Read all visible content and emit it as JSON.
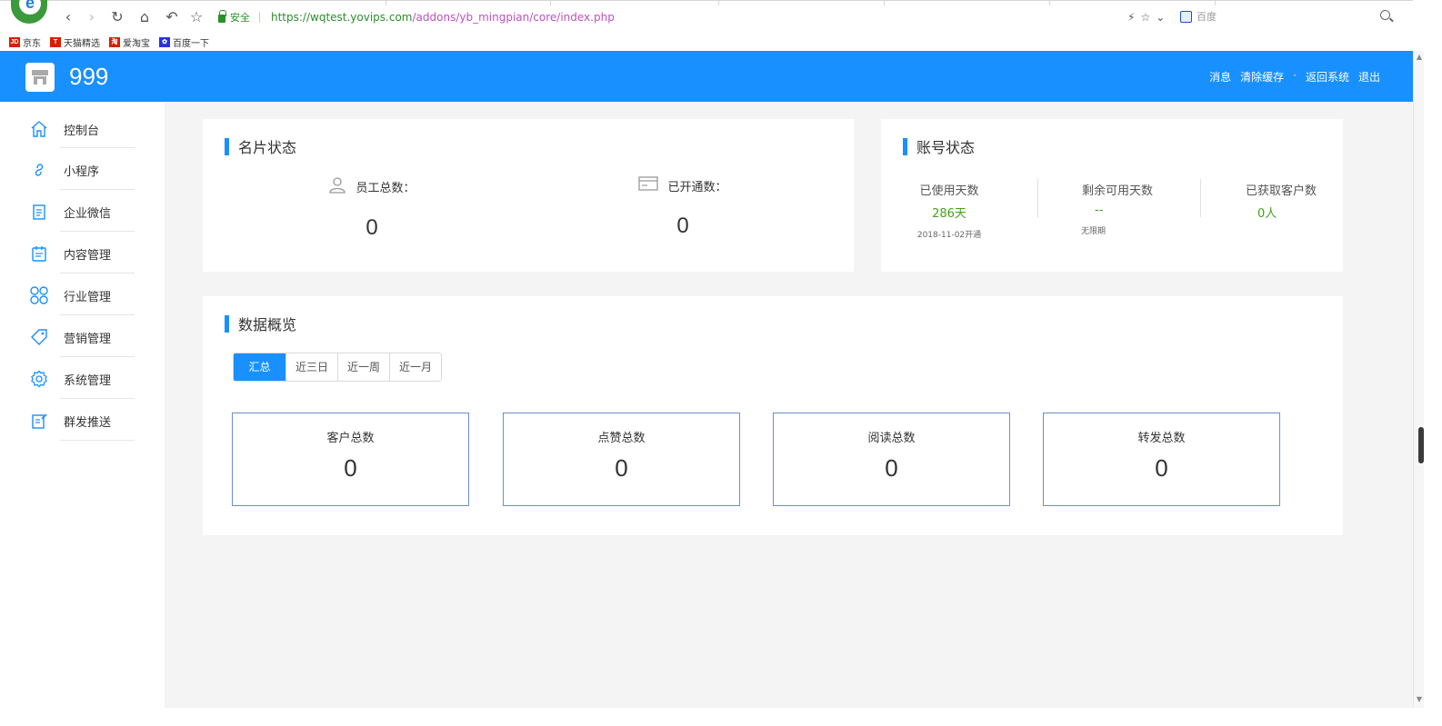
{
  "browser": {
    "secure_label": "安全",
    "url_host": "https://wqtest.yovips.com",
    "url_path": "/addons/yb_mingpian/core/index.php",
    "search_engine": "百度",
    "bookmarks": [
      {
        "label": "京东",
        "icon": "jd-icon",
        "color": "#d81e06",
        "mark": "JD"
      },
      {
        "label": "天猫精选",
        "icon": "tmall-icon",
        "color": "#d81e06",
        "mark": "T"
      },
      {
        "label": "爱淘宝",
        "icon": "aitaobao-icon",
        "color": "#d81e06",
        "mark": "淘"
      },
      {
        "label": "百度一下",
        "icon": "baidu-icon",
        "color": "#2932e1",
        "mark": "✿"
      }
    ]
  },
  "header": {
    "title": "999",
    "links": [
      "消息",
      "清除缓存",
      "返回系统",
      "退出"
    ],
    "bg_color": "#1890ff"
  },
  "sidebar": {
    "items": [
      {
        "label": "控制台",
        "icon": "home-icon"
      },
      {
        "label": "小程序",
        "icon": "link-icon"
      },
      {
        "label": "企业微信",
        "icon": "document-icon"
      },
      {
        "label": "内容管理",
        "icon": "clipboard-icon"
      },
      {
        "label": "行业管理",
        "icon": "grid-icon"
      },
      {
        "label": "营销管理",
        "icon": "tag-icon"
      },
      {
        "label": "系统管理",
        "icon": "gear-icon"
      },
      {
        "label": "群发推送",
        "icon": "edit-icon"
      }
    ]
  },
  "card_status": {
    "title": "名片状态",
    "staff_label": "员工总数：",
    "staff_value": "0",
    "opened_label": "已开通数：",
    "opened_value": "0"
  },
  "account_status": {
    "title": "账号状态",
    "used_days_label": "已使用天数",
    "used_days_value": "286天",
    "used_days_sub": "2018-11-02开通",
    "remaining_label": "剩余可用天数",
    "remaining_value": "--",
    "remaining_sub": "无限期",
    "customers_label": "已获取客户数",
    "customers_value": "0人"
  },
  "overview": {
    "title": "数据概览",
    "tabs": [
      "汇总",
      "近三日",
      "近一周",
      "近一月"
    ],
    "active_tab": 0,
    "metrics": [
      {
        "label": "客户总数",
        "value": "0"
      },
      {
        "label": "点赞总数",
        "value": "0"
      },
      {
        "label": "阅读总数",
        "value": "0"
      },
      {
        "label": "转发总数",
        "value": "0"
      }
    ]
  },
  "colors": {
    "accent": "#1890ff",
    "green_value": "#44a11b",
    "metric_border": "#6d8fc9"
  }
}
